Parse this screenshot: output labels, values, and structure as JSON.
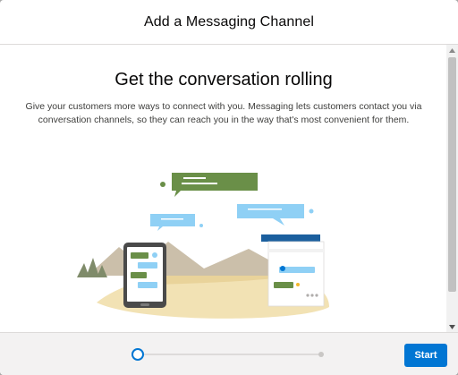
{
  "modal": {
    "title": "Add a Messaging Channel"
  },
  "body": {
    "headline": "Get the conversation rolling",
    "description": "Give your customers more ways to connect with you. Messaging lets customers contact you via conversation channels, so they can reach you in the way that's most convenient for them."
  },
  "illustration": {
    "icons": [
      "chat-bubbles-icon",
      "phone-icon",
      "browser-window-icon",
      "mountains-icon"
    ]
  },
  "progress": {
    "current_step": 1,
    "total_steps": 2
  },
  "footer": {
    "start_label": "Start"
  },
  "colors": {
    "accent": "#0176d3",
    "bubble_green": "#6a8f48",
    "bubble_blue": "#8fd0f5",
    "footer_bg": "#f3f2f2"
  }
}
